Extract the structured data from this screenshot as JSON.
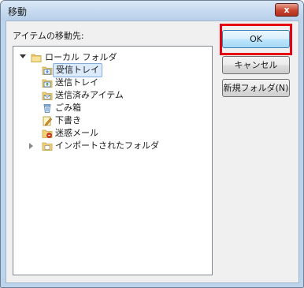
{
  "dialog": {
    "title": "移動",
    "close_glyph": "x"
  },
  "destination_label": "アイテムの移動先:",
  "tree": {
    "root": {
      "label": "ローカル フォルダ",
      "icon": "folder-icon"
    },
    "items": [
      {
        "label": "受信トレイ",
        "icon": "inbox-icon",
        "selected": true
      },
      {
        "label": "送信トレイ",
        "icon": "outbox-icon"
      },
      {
        "label": "送信済みアイテム",
        "icon": "sent-items-icon"
      },
      {
        "label": "ごみ箱",
        "icon": "trash-icon"
      },
      {
        "label": "下書き",
        "icon": "drafts-icon"
      },
      {
        "label": "迷惑メール",
        "icon": "junk-mail-icon"
      },
      {
        "label": "インポートされたフォルダ",
        "icon": "imported-folder-icon",
        "collapsed": true
      }
    ]
  },
  "buttons": {
    "ok": "OK",
    "cancel": "キャンセル",
    "new_folder": "新規フォルダ(N)"
  },
  "colors": {
    "highlight": "#e60012",
    "selection": "#dcebfc",
    "primary_button": "#bee6fd"
  }
}
